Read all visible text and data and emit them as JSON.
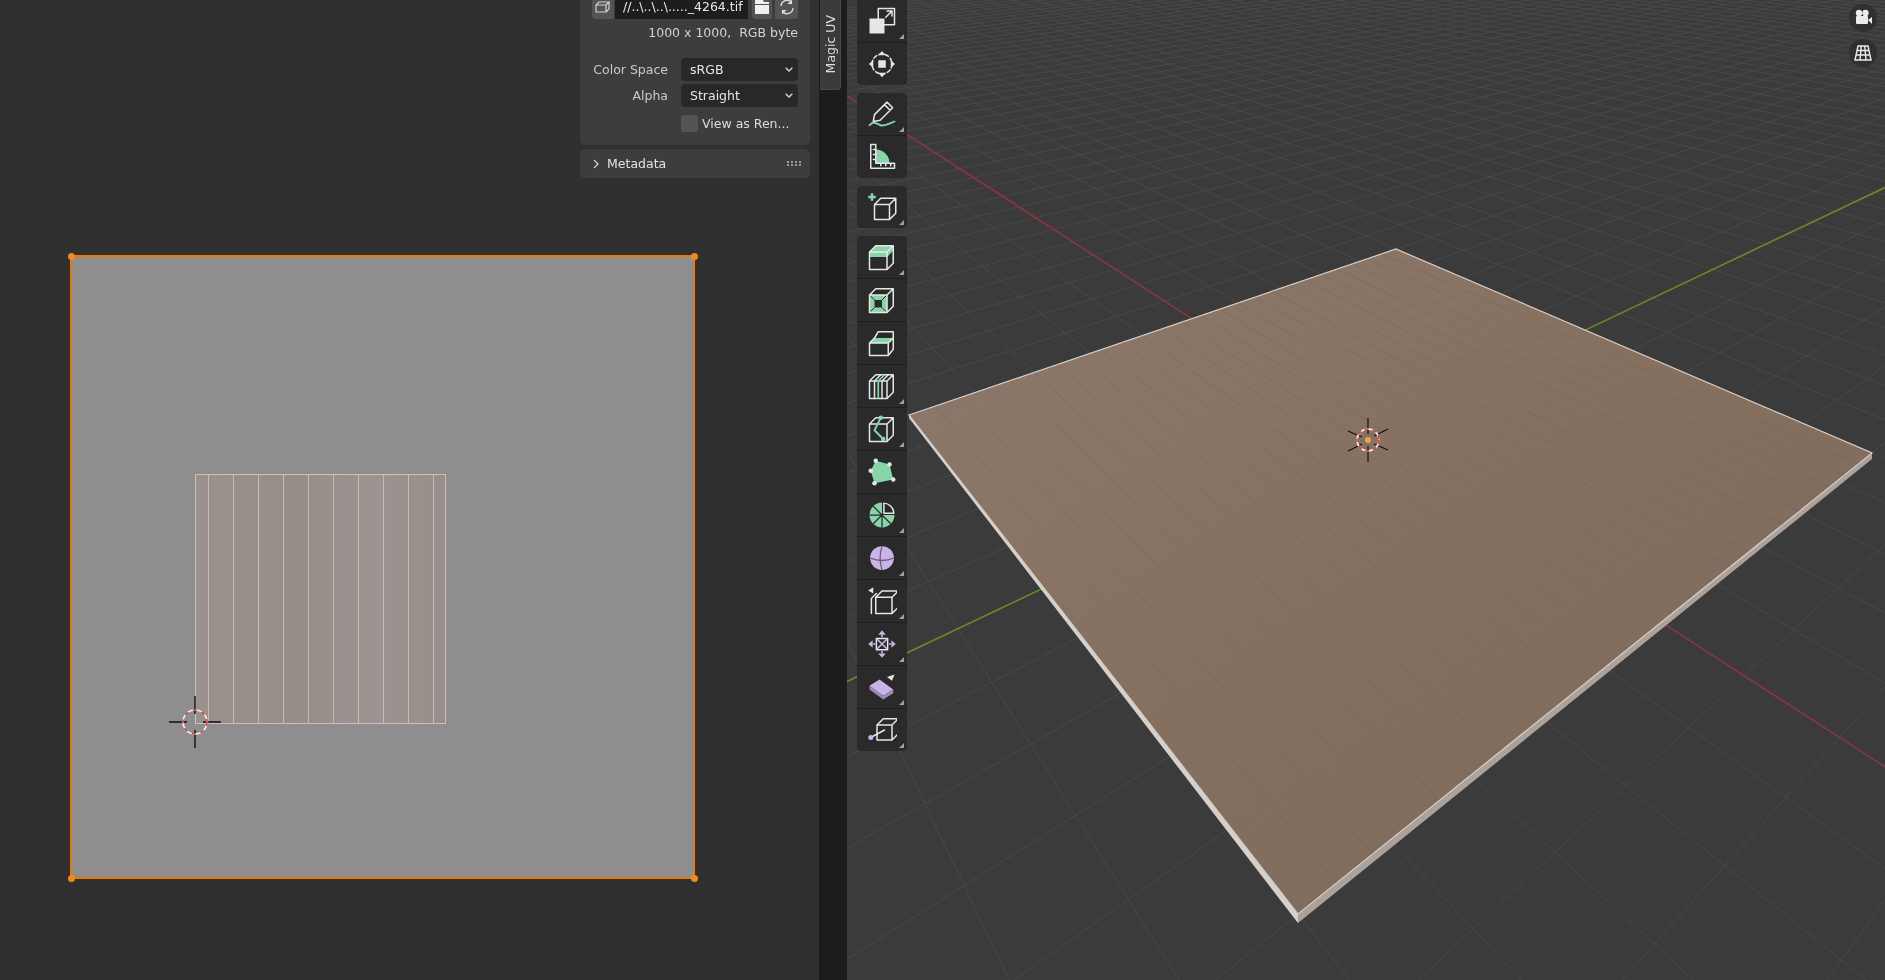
{
  "uv_editor": {
    "image_panel": {
      "file_path": "//..\\..\\..\\....._4264.tif",
      "image_info": "1000 x 1000,  RGB byte",
      "fields": [
        {
          "label": "Color Space",
          "value": "sRGB"
        },
        {
          "label": "Alpha",
          "value": "Straight"
        }
      ],
      "view_as_render": {
        "label": "View as Ren...",
        "checked": false
      }
    },
    "subpanels": [
      {
        "title": "Metadata",
        "expanded": false
      }
    ],
    "sidebar_tabs": [
      {
        "label": "Magic UV",
        "selected": true
      }
    ]
  },
  "viewport": {
    "toolbar": [
      {
        "tools": [
          {
            "kind": "scale",
            "selected": false,
            "submenu": true
          },
          {
            "kind": "transform",
            "selected": false,
            "submenu": false
          }
        ]
      },
      {
        "tools": [
          {
            "kind": "annotate",
            "selected": false,
            "submenu": true
          },
          {
            "kind": "measure",
            "selected": false,
            "submenu": false
          }
        ]
      },
      {
        "tools": [
          {
            "kind": "addcube",
            "selected": false,
            "submenu": true
          }
        ]
      },
      {
        "tools": [
          {
            "kind": "extrude",
            "selected": false,
            "submenu": true
          },
          {
            "kind": "inset",
            "selected": false,
            "submenu": false
          },
          {
            "kind": "bevel",
            "selected": false,
            "submenu": false
          },
          {
            "kind": "loopcut",
            "selected": false,
            "submenu": true
          },
          {
            "kind": "knife",
            "selected": false,
            "submenu": true
          },
          {
            "kind": "polybuild",
            "selected": false,
            "submenu": false
          },
          {
            "kind": "spin",
            "selected": false,
            "submenu": true
          },
          {
            "kind": "smooth",
            "selected": false,
            "submenu": true
          },
          {
            "kind": "edgeslide",
            "selected": false,
            "submenu": true
          },
          {
            "kind": "shrink",
            "selected": false,
            "submenu": true
          },
          {
            "kind": "shear",
            "selected": false,
            "submenu": true
          },
          {
            "kind": "rip",
            "selected": false,
            "submenu": true
          }
        ]
      }
    ]
  }
}
